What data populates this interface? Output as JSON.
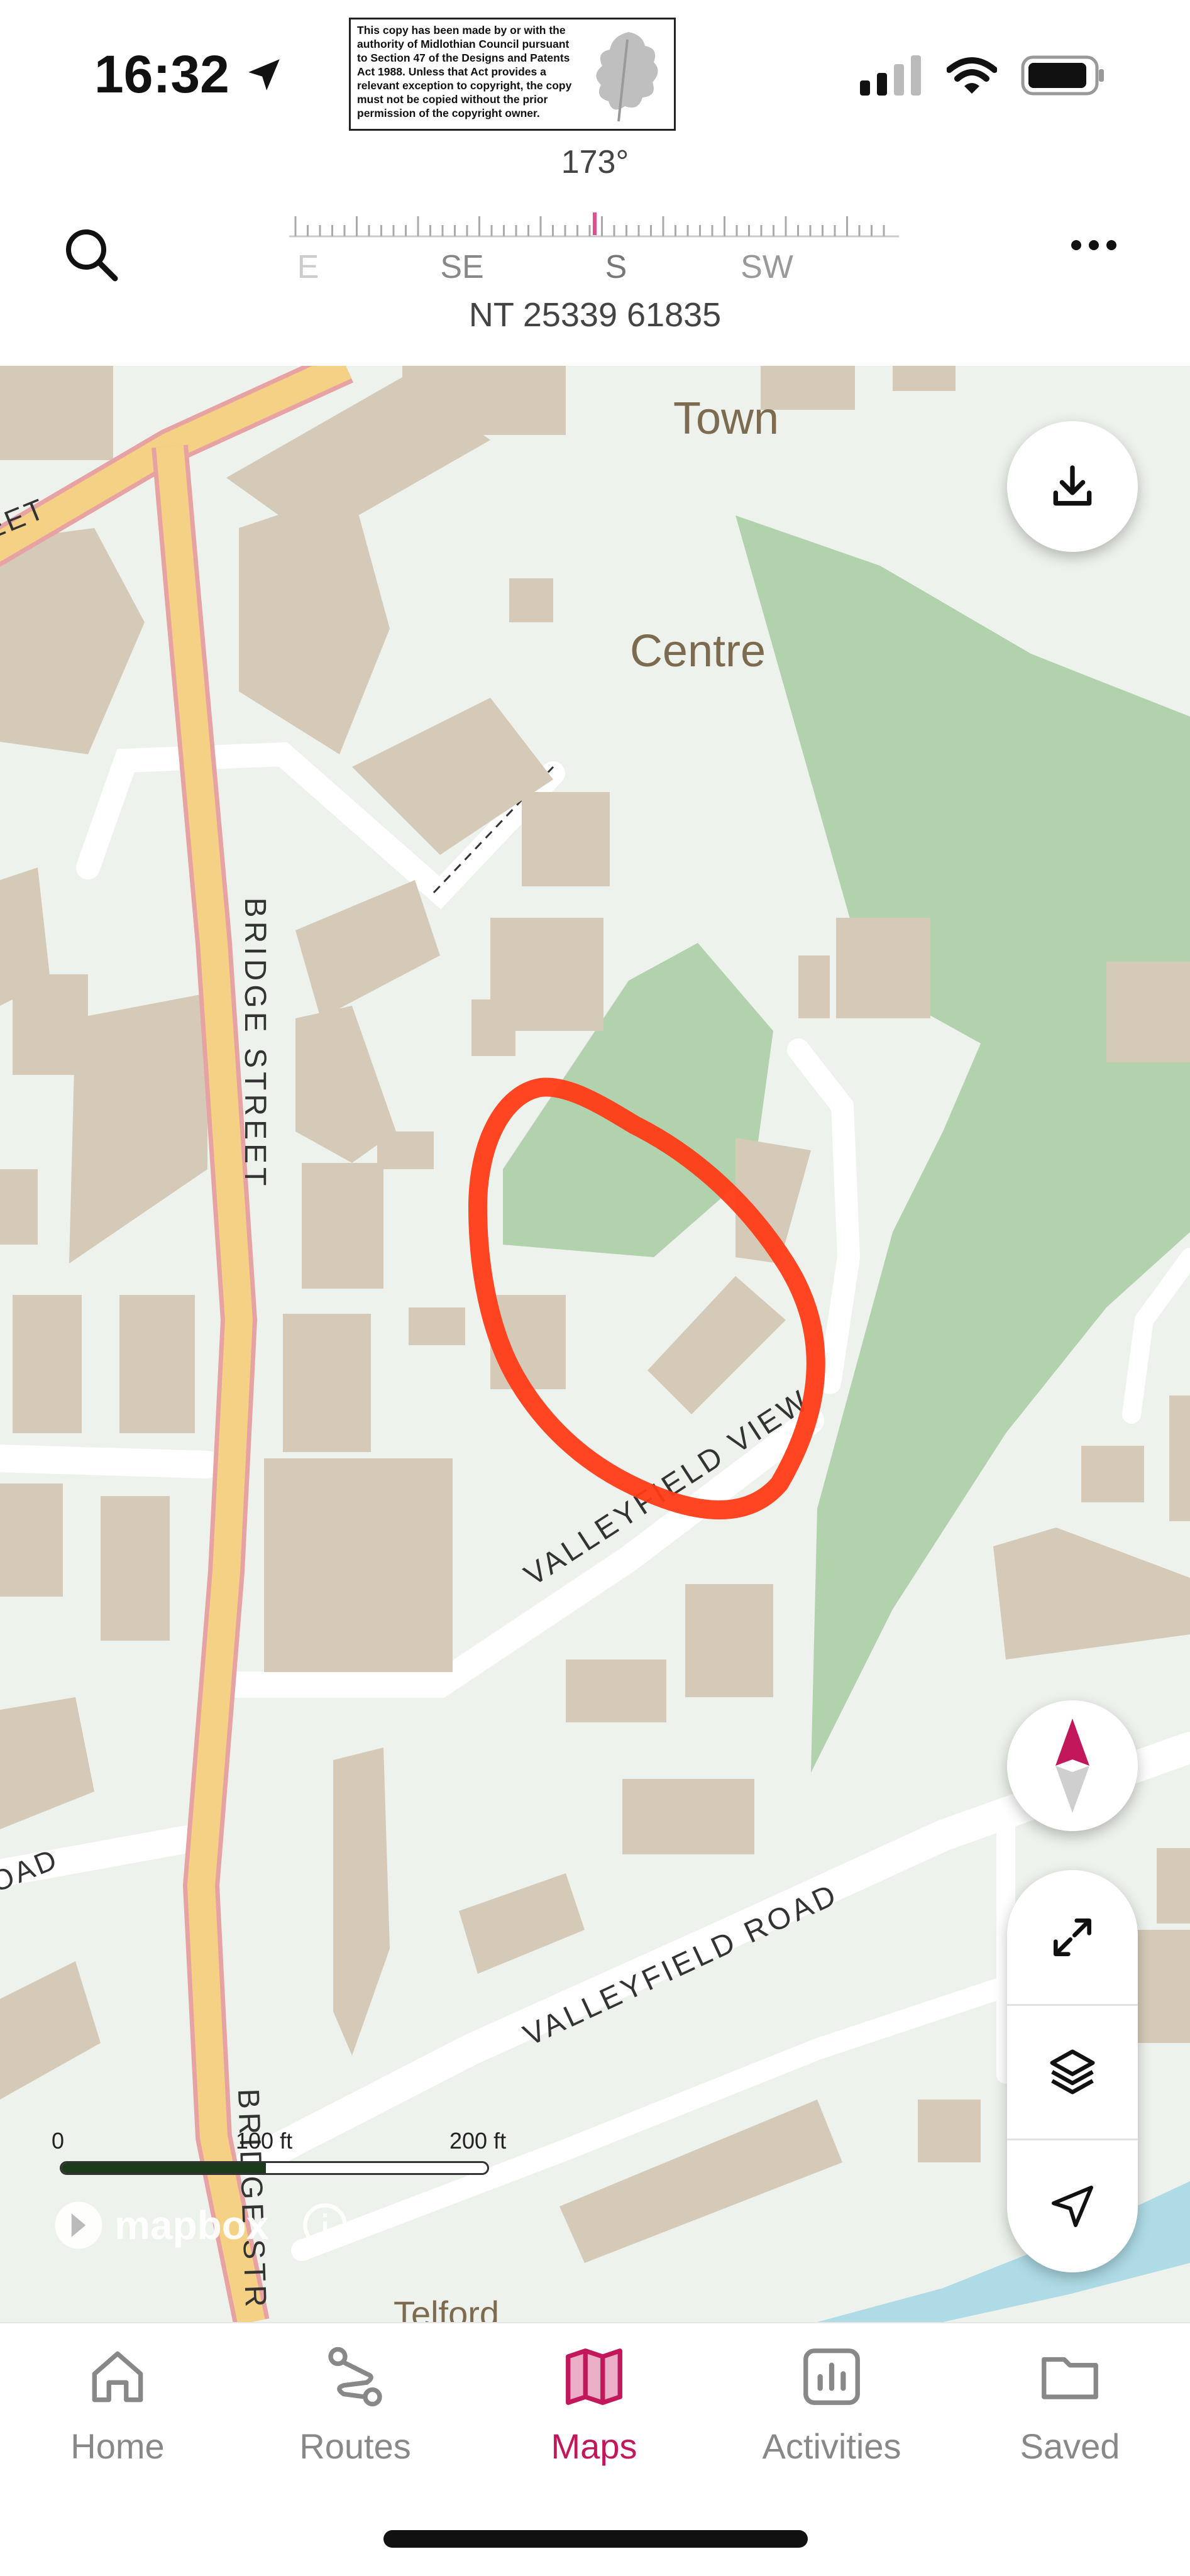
{
  "status_bar": {
    "time": "16:32"
  },
  "copyright_notice": "This copy has been made by or with the authority of Midlothian Council pursuant to Section 47 of the Designs and Patents Act 1988. Unless that Act provides a relevant exception to copyright, the copy must not be copied without the prior permission of the copyright owner.",
  "header": {
    "heading": "173°",
    "grid_reference": "NT 25339 61835",
    "compass_labels": [
      "E",
      "SE",
      "S",
      "SW"
    ]
  },
  "map": {
    "place_labels": [
      "Town",
      "Centre",
      "Telford"
    ],
    "street_labels": [
      "EET",
      "BRIDGE STREET",
      "VALLEYFIELD VIEW",
      "VALLEYFIELD ROAD",
      "OAD",
      "BRIDGE STR"
    ],
    "scale": {
      "labels": [
        "0",
        "100 ft",
        "200 ft"
      ]
    },
    "attribution": "mapbox",
    "annotation_color": "#ff3b16"
  },
  "tabs": [
    {
      "label": "Home",
      "icon": "home-icon",
      "active": false
    },
    {
      "label": "Routes",
      "icon": "routes-icon",
      "active": false
    },
    {
      "label": "Maps",
      "icon": "map-icon",
      "active": true
    },
    {
      "label": "Activities",
      "icon": "activities-icon",
      "active": false
    },
    {
      "label": "Saved",
      "icon": "folder-icon",
      "active": false
    }
  ],
  "colors": {
    "accent": "#c2185b",
    "building": "#d4cab7",
    "park": "#b2d2ae",
    "main_road": "#f4d185",
    "water": "#aedbe6"
  }
}
